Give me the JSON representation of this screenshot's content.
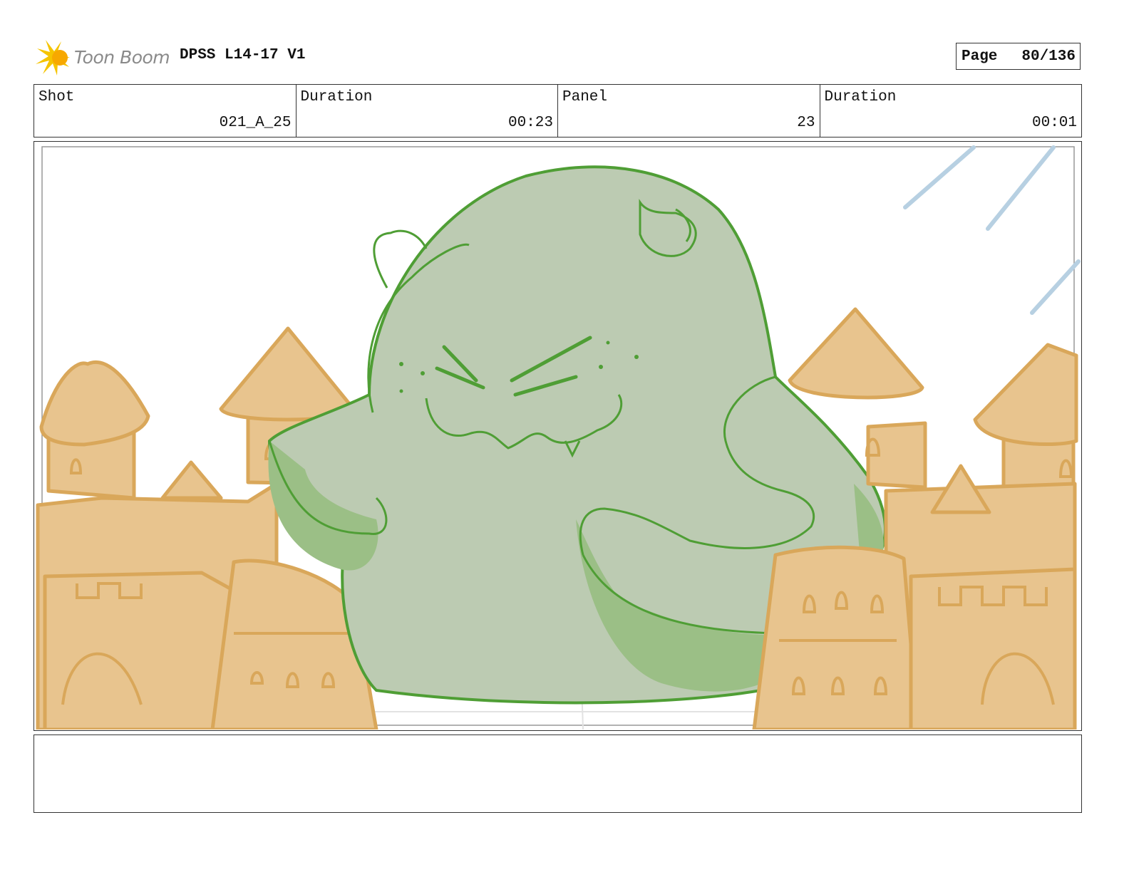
{
  "header": {
    "logo_text": "Toon Boom",
    "title": "DPSS L14-17 V1",
    "page_label": "Page",
    "page_value": "80/136"
  },
  "info": {
    "shot_label": "Shot",
    "shot_value": "021_A_25",
    "shot_duration_label": "Duration",
    "shot_duration_value": "00:23",
    "panel_label": "Panel",
    "panel_value": "23",
    "panel_duration_label": "Duration",
    "panel_duration_value": "00:01"
  },
  "colors": {
    "sand": "#e8c48e",
    "sand_line": "#d9a75a",
    "blob_fill": "#bccbb2",
    "blob_line": "#4f9e35",
    "blob_shade": "#9bbf86",
    "speed_lines": "#b7d0e2"
  }
}
